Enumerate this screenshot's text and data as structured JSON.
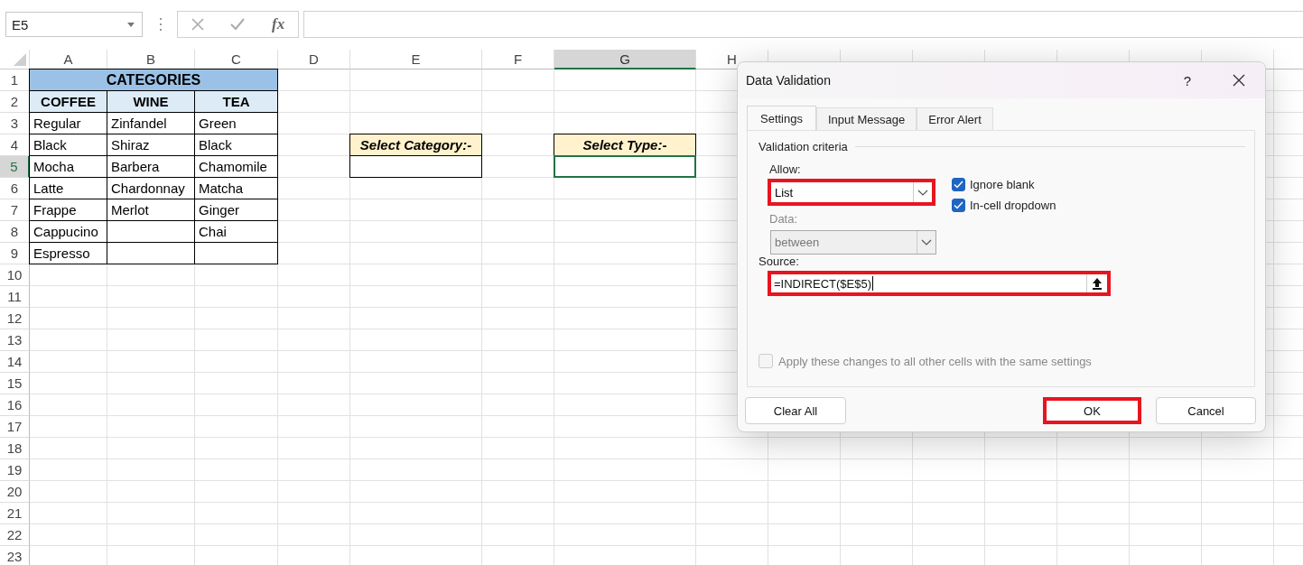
{
  "formula_bar": {
    "name_box": "E5",
    "function_label": "fx"
  },
  "column_headers": [
    {
      "label": "A",
      "selected": false
    },
    {
      "label": "B",
      "selected": false
    },
    {
      "label": "C",
      "selected": false
    },
    {
      "label": "D",
      "selected": false
    },
    {
      "label": "E",
      "selected": false
    },
    {
      "label": "F",
      "selected": false
    },
    {
      "label": "G",
      "selected": true
    },
    {
      "label": "H",
      "selected": false
    }
  ],
  "row_headers": [
    {
      "label": "1",
      "selected": false
    },
    {
      "label": "2",
      "selected": false
    },
    {
      "label": "3",
      "selected": false
    },
    {
      "label": "4",
      "selected": false
    },
    {
      "label": "5",
      "selected": true
    },
    {
      "label": "6",
      "selected": false
    },
    {
      "label": "7",
      "selected": false
    },
    {
      "label": "8",
      "selected": false
    },
    {
      "label": "9",
      "selected": false
    },
    {
      "label": "10",
      "selected": false
    },
    {
      "label": "11",
      "selected": false
    },
    {
      "label": "12",
      "selected": false
    },
    {
      "label": "13",
      "selected": false
    },
    {
      "label": "14",
      "selected": false
    },
    {
      "label": "15",
      "selected": false
    },
    {
      "label": "16",
      "selected": false
    },
    {
      "label": "17",
      "selected": false
    },
    {
      "label": "18",
      "selected": false
    },
    {
      "label": "19",
      "selected": false
    },
    {
      "label": "20",
      "selected": false
    },
    {
      "label": "21",
      "selected": false
    },
    {
      "label": "22",
      "selected": false
    },
    {
      "label": "23",
      "selected": false
    }
  ],
  "categories_table": {
    "title": "CATEGORIES",
    "columns": [
      {
        "heading": "COFFEE",
        "items": [
          "Regular",
          "Black",
          "Mocha",
          "Latte",
          "Frappe",
          "Cappucino",
          "Espresso"
        ]
      },
      {
        "heading": "WINE",
        "items": [
          "Zinfandel",
          "Shiraz",
          "Barbera",
          "Chardonnay",
          "Merlot"
        ]
      },
      {
        "heading": "TEA",
        "items": [
          "Green",
          "Black",
          "Chamomile",
          "Matcha",
          "Ginger",
          "Chai"
        ]
      }
    ]
  },
  "select_category": {
    "label": "Select Category:-",
    "input_selected": false
  },
  "select_type": {
    "label": "Select Type:-",
    "input_selected": true
  },
  "dialog": {
    "title": "Data Validation",
    "help": "?",
    "tabs": [
      {
        "label": "Settings",
        "selected": true
      },
      {
        "label": "Input Message",
        "selected": false
      },
      {
        "label": "Error Alert",
        "selected": false
      }
    ],
    "group_label": "Validation criteria",
    "allow": {
      "label": "Allow:",
      "value": "List",
      "highlighted": true
    },
    "checkboxes": [
      {
        "label": "Ignore blank",
        "checked": true
      },
      {
        "label": "In-cell dropdown",
        "checked": true
      }
    ],
    "data": {
      "label": "Data:",
      "value": "between",
      "disabled": true
    },
    "source": {
      "label": "Source:",
      "value": "=INDIRECT($E$5)",
      "highlighted": true
    },
    "apply_all": {
      "label": "Apply these changes to all other cells with the same settings",
      "checked": false,
      "disabled": true
    },
    "buttons": [
      {
        "label": "Clear All",
        "highlighted": false
      },
      {
        "label": "OK",
        "highlighted": true
      },
      {
        "label": "Cancel",
        "highlighted": false
      }
    ]
  }
}
